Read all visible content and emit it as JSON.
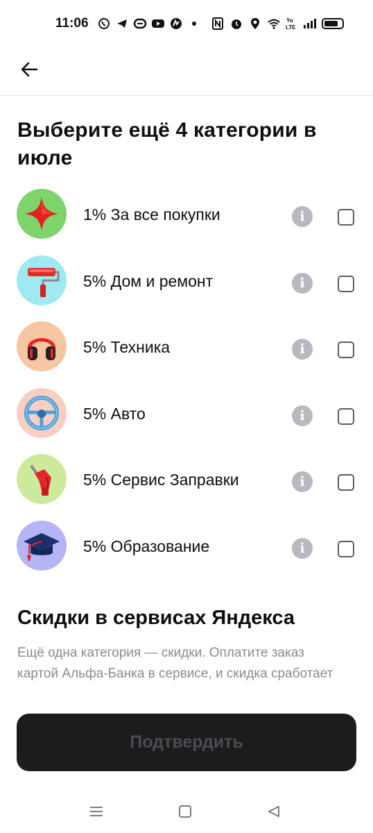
{
  "status_bar": {
    "time": "11:06",
    "network_label": "Yo\nLTE",
    "left_icons": [
      "viber-icon",
      "telegram-icon",
      "chat-icon",
      "youtube-icon",
      "app-icon",
      "dot-icon"
    ],
    "right_icons": [
      "nfc-icon",
      "alarm-icon",
      "location-icon",
      "wifi-icon",
      "lte-icon",
      "signal-icon",
      "battery-icon"
    ]
  },
  "header": {
    "back_icon": "arrow-left-icon"
  },
  "page": {
    "title": "Выберите ещё 4 категории в июле"
  },
  "categories": [
    {
      "label": "1% За все покупки",
      "icon": "red-star-icon",
      "bg": "#7ed36a",
      "checked": false
    },
    {
      "label": "5% Дом и ремонт",
      "icon": "paint-roller-icon",
      "bg": "#9ee9f2",
      "checked": false
    },
    {
      "label": "5% Техника",
      "icon": "headphones-icon",
      "bg": "#f6c5a2",
      "checked": false
    },
    {
      "label": "5% Авто",
      "icon": "steering-wheel-icon",
      "bg": "#f8cfc2",
      "checked": false
    },
    {
      "label": "5% Сервис Заправки",
      "icon": "fuel-nozzle-icon",
      "bg": "#cdea9c",
      "checked": false
    },
    {
      "label": "5% Образование",
      "icon": "graduation-cap-icon",
      "bg": "#b3b5f5",
      "checked": false
    }
  ],
  "section": {
    "title": "Скидки в сервисах Яндекса",
    "description": "Ещё одна категория — скидки. Оплатите заказ картой Альфа-Банка в сервисе, и скидка сработает"
  },
  "confirm": {
    "label": "Подтвердить",
    "enabled": false
  },
  "nav": {
    "icons": [
      "menu-icon",
      "home-square-icon",
      "back-triangle-icon"
    ]
  },
  "colors": {
    "accent_dark": "#1c1c1f",
    "button_text_disabled": "#4b4b50",
    "info_icon": "#b8b9c0",
    "secondary_text": "#8a8b93"
  }
}
